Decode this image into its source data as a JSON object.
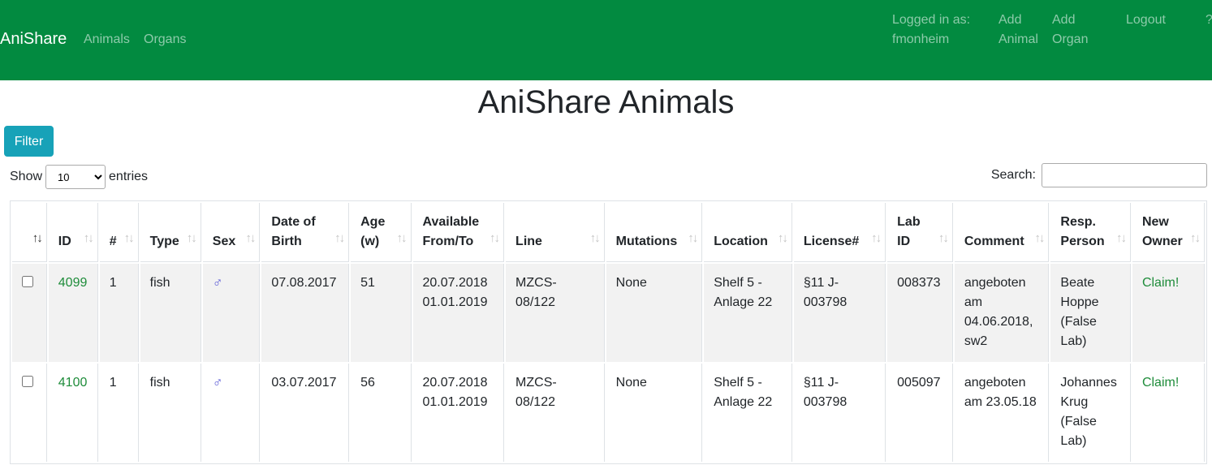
{
  "navbar": {
    "brand": "AniShare",
    "links": [
      "Animals",
      "Organs"
    ],
    "logged_in": "Logged in as: fmonheim",
    "add_animal": "Add Animal",
    "add_organ": "Add Organ",
    "logout": "Logout",
    "help": "?",
    "color": "#028a40"
  },
  "page": {
    "title": "AniShare Animals"
  },
  "filter_button": "Filter",
  "length": {
    "prefix": "Show",
    "value": "10",
    "suffix": "entries"
  },
  "search": {
    "label": "Search:",
    "value": ""
  },
  "table": {
    "headers": [
      "",
      "ID",
      "#",
      "Type",
      "Sex",
      "Date of Birth",
      "Age (w)",
      "Available From/To",
      "Line",
      "Mutations",
      "Location",
      "License#",
      "Lab ID",
      "Comment",
      "Resp. Person",
      "New Owner"
    ],
    "rows": [
      {
        "id": "4099",
        "count": "1",
        "type": "fish",
        "sex": "♂",
        "dob": "07.08.2017",
        "age": "51",
        "available": "20.07.2018 01.01.2019",
        "line": "MZCS-08/122",
        "mutations": "None",
        "location": "Shelf 5 - Anlage 22",
        "license": "§11 J-003798",
        "lab_id": "008373",
        "comment": "angeboten am 04.06.2018, sw2",
        "resp_person": "Beate Hoppe (False Lab)",
        "new_owner": "Claim!"
      },
      {
        "id": "4100",
        "count": "1",
        "type": "fish",
        "sex": "♂",
        "dob": "03.07.2017",
        "age": "56",
        "available": "20.07.2018 01.01.2019",
        "line": "MZCS-08/122",
        "mutations": "None",
        "location": "Shelf 5 - Anlage 22",
        "license": "§11 J-003798",
        "lab_id": "005097",
        "comment": "angeboten am 23.05.18",
        "resp_person": "Johannes Krug (False Lab)",
        "new_owner": "Claim!"
      }
    ]
  },
  "icons": {
    "sort": "sort-arrows-icon",
    "sex": "male-symbol-icon"
  }
}
